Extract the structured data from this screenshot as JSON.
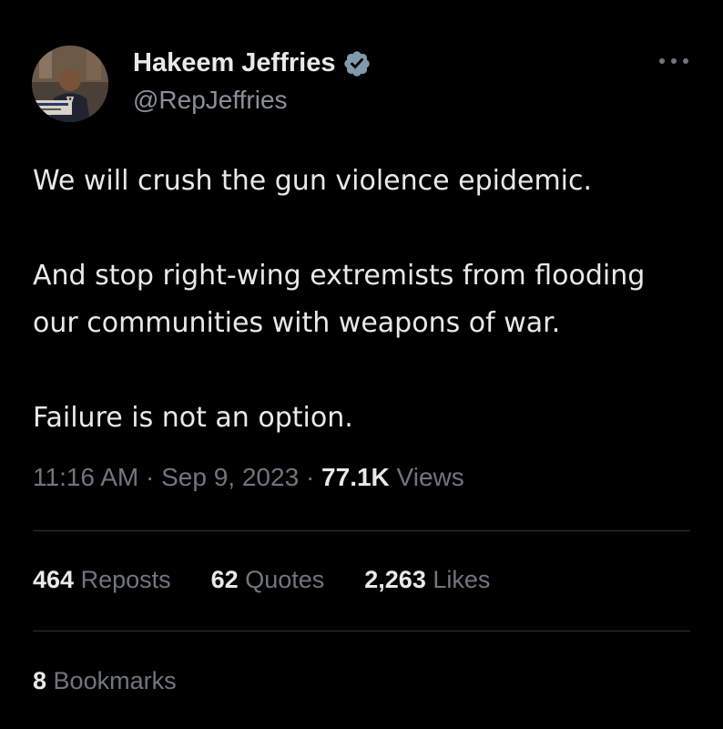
{
  "author": {
    "name": "Hakeem Jeffries",
    "handle": "@RepJeffries",
    "verified": true,
    "avatar_icon": "profile-photo"
  },
  "tweet": {
    "paragraphs": [
      [
        "We will crush the gun violence epidemic."
      ],
      [
        "And stop right-wing extremists from flooding",
        "our communities with weapons of war."
      ],
      [
        "Failure is not an option."
      ]
    ]
  },
  "meta": {
    "time": "11:16 AM",
    "date": "Sep 9, 2023",
    "views_count": "77.1K",
    "views_label": "Views",
    "separator": "·"
  },
  "engagement": {
    "reposts_count": "464",
    "reposts_label": "Reposts",
    "quotes_count": "62",
    "quotes_label": "Quotes",
    "likes_count": "2,263",
    "likes_label": "Likes",
    "bookmarks_count": "8",
    "bookmarks_label": "Bookmarks"
  },
  "colors": {
    "background": "#000000",
    "text_primary": "#e7e9ea",
    "text_secondary": "#71767b",
    "verified_badge": "#829aab",
    "divider": "#2f3336"
  }
}
